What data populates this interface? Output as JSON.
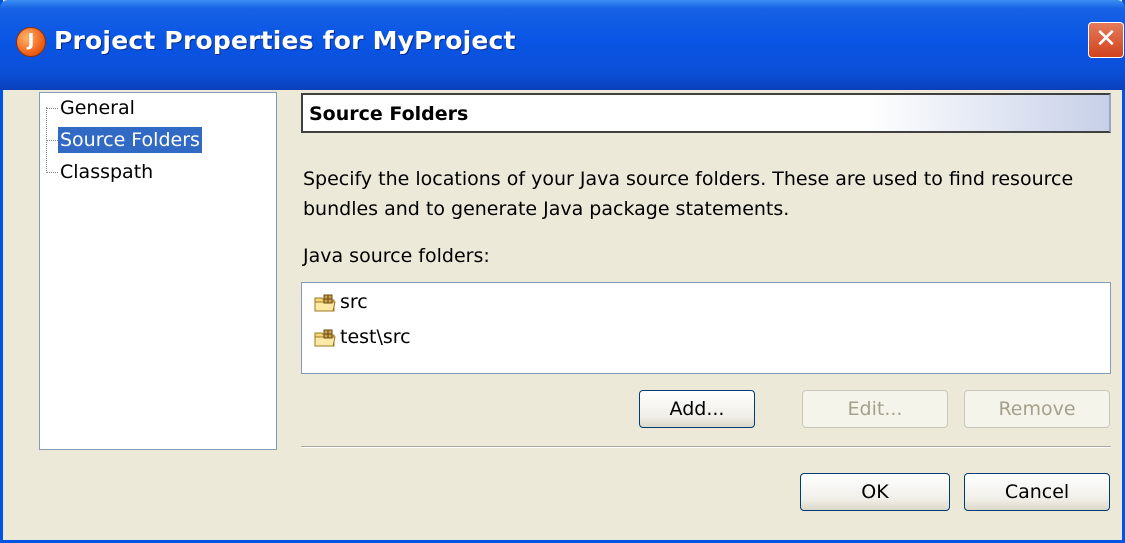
{
  "window": {
    "title": "Project Properties for MyProject",
    "close_symbol": "✕"
  },
  "nav": {
    "items": [
      {
        "label": "General"
      },
      {
        "label": "Source Folders",
        "selected": true
      },
      {
        "label": "Classpath"
      }
    ]
  },
  "section": {
    "title": "Source Folders",
    "description": "Specify the locations of your Java source folders. These are used to find resource bundles and to generate Java package statements.",
    "list_label": "Java source folders:",
    "folders": [
      {
        "name": "src"
      },
      {
        "name": "test\\src"
      }
    ]
  },
  "buttons": {
    "add": "Add...",
    "edit": "Edit...",
    "remove": "Remove",
    "ok": "OK",
    "cancel": "Cancel"
  },
  "colors": {
    "titlebar": "#0a55e5",
    "selection": "#316ac5",
    "dialog_bg": "#ece9d8"
  }
}
